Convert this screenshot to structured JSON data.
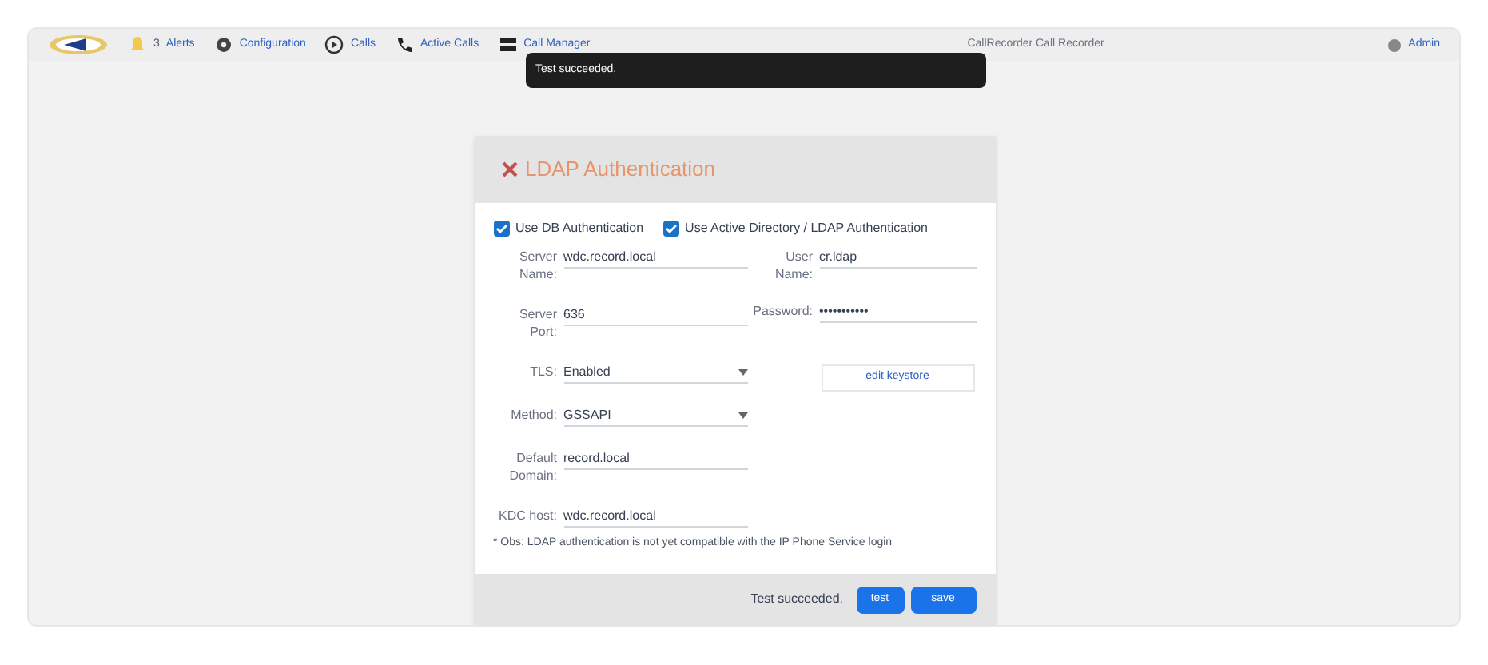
{
  "navbar": {
    "items": [
      {
        "kind": "alerts",
        "label": "Alerts",
        "count": "3"
      },
      {
        "kind": "config",
        "label": "Configuration"
      },
      {
        "kind": "calls",
        "label": "Calls"
      },
      {
        "kind": "active",
        "label": "Active Calls"
      },
      {
        "kind": "manager",
        "label": "Call Manager"
      }
    ],
    "title": "CallRecorder Call Recorder",
    "user": "Admin"
  },
  "toast": {
    "message": "Test succeeded."
  },
  "dialog": {
    "title": "LDAP Authentication",
    "checkboxes": [
      {
        "label": "Use DB Authentication",
        "checked": true
      },
      {
        "label": "Use Active Directory / LDAP Authentication",
        "checked": true
      }
    ],
    "left_fields": [
      {
        "kind": "text",
        "label": "Server Name:",
        "value": "wdc.record.local"
      },
      {
        "kind": "text",
        "label": "Server Port:",
        "value": "636"
      },
      {
        "kind": "select",
        "label": "TLS:",
        "value": "Enabled"
      },
      {
        "kind": "select",
        "label": "Method:",
        "value": "GSSAPI"
      },
      {
        "kind": "text",
        "label": "Default Domain:",
        "value": "record.local"
      },
      {
        "kind": "text",
        "label": "KDC host:",
        "value": "wdc.record.local"
      }
    ],
    "right_fields": [
      {
        "label": "User Name:",
        "value": "cr.ldap"
      },
      {
        "label": "Password:",
        "value": "•••••••••••"
      }
    ],
    "keystore_button": "edit keystore",
    "note": "* Obs: LDAP authentication is not yet compatible with the IP Phone Service login",
    "status": "Test succeeded.",
    "buttons": [
      "test",
      "save"
    ]
  }
}
